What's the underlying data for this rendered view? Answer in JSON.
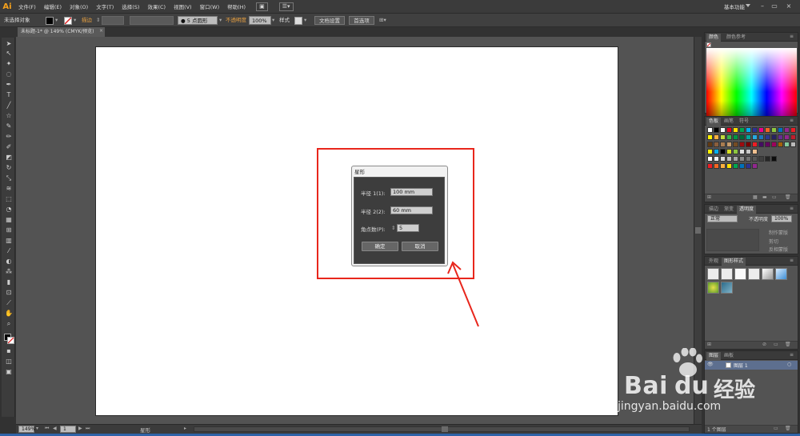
{
  "app": {
    "logo": "Ai",
    "workspace": "基本功能"
  },
  "menu": [
    "文件(F)",
    "编辑(E)",
    "对象(O)",
    "文字(T)",
    "选择(S)",
    "效果(C)",
    "视图(V)",
    "窗口(W)",
    "帮助(H)"
  ],
  "menu_box": "☰▾",
  "control": {
    "selection": "未选择对象",
    "stroke_label": "描边",
    "brush": "● 5 点圆形",
    "opacity_label": "不透明度",
    "opacity_value": "100%",
    "style_label": "样式",
    "doc_settings": "文档设置",
    "preferences": "首选项"
  },
  "document": {
    "tab": "未标题-1* @ 149% (CMYK/预览)",
    "close": "×"
  },
  "dialog": {
    "title": "星形",
    "radius1_label": "半径 1(1):",
    "radius1_value": "100 mm",
    "radius2_label": "半径 2(2):",
    "radius2_value": "60 mm",
    "points_label": "角点数(P):",
    "points_value": "5",
    "ok": "确定",
    "cancel": "取消"
  },
  "status": {
    "zoom": "149%",
    "page": "1",
    "tool": "星形"
  },
  "panels": {
    "color_tabs": [
      "颜色",
      "颜色参考"
    ],
    "swatch_tabs": [
      "色板",
      "画笔",
      "符号"
    ],
    "transparency_tabs": [
      "描边",
      "渐变",
      "透明度"
    ],
    "blend_mode": "正常",
    "opacity_label": "不透明度",
    "opacity_value": "100%",
    "make_mask": "制作蒙版",
    "clip": "剪切",
    "invert_mask": "反相蒙版",
    "appearance_tabs": [
      "外观",
      "图形样式"
    ],
    "layers_tabs": [
      "图层",
      "画板"
    ],
    "layer_name": "图层 1",
    "layer_count": "1 个图层"
  },
  "watermark": {
    "brand": "Bai",
    "brand2": "du",
    "cn": "经验",
    "url": "jingyan.baidu.com"
  },
  "colors": {
    "accent": "#f7a21b",
    "highlight": "#e8261c",
    "stroke_label": "#e8a040"
  }
}
